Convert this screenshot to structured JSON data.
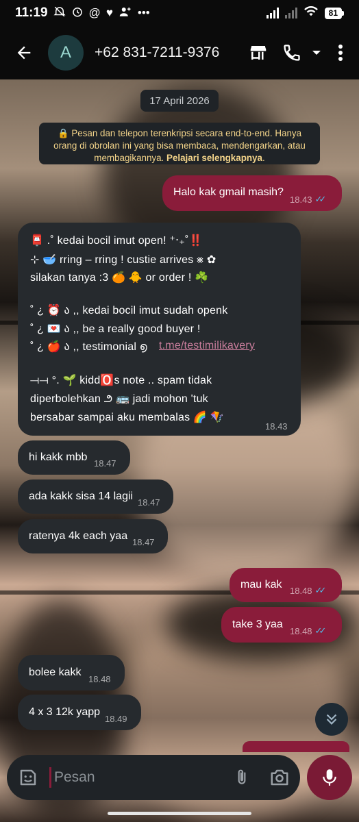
{
  "status_bar": {
    "time": "11:19",
    "icons": [
      "alarm-off-icon",
      "alarm-icon",
      "at-icon",
      "heart-icon",
      "add-user-icon",
      "more-dots-icon"
    ],
    "battery": "81"
  },
  "header": {
    "avatar_letter": "A",
    "contact_name": "+62 831-7211-9376"
  },
  "chat": {
    "date": "17 April 2026",
    "encryption_notice": "🔒 Pesan dan telepon terenkripsi secara end-to-end. Hanya orang di obrolan ini yang bisa membaca, mendengarkan, atau membagikannya.",
    "encryption_link": "Pelajari selengkapnya",
    "encryption_period": ".",
    "messages": [
      {
        "text": "Halo kak gmail masih?",
        "time": "18.43",
        "direction": "out",
        "read": true
      },
      {
        "time": "18.43",
        "direction": "in",
        "lines": [
          "📮  .˚ kedai  bocil  imut  open!  ⁺‧₊˚‼️",
          "⊹ 🥣 rring – rring !  custie  arrives ⨳ ✿",
          "silakan  tanya  :3 🍊 🐥  or  order ! ☘️",
          "",
          "˚ ¿ ⏰  ა  ,,  kedai bocil imut sudah openk",
          "˚ ¿ 💌  ა  ,,  be  a  really  good  buyer !",
          "˚ ¿ 🍎  ა  ,,  testimonial  ൭",
          "",
          "⟞⟞ °. 🌱  kidd🅾️s note  ..  spam  tidak",
          "diperbolehkan  ౨ 🚌  jadi  mohon  'tuk",
          "bersabar sampai aku membalas 🌈 🪁"
        ],
        "link": "t.me/testimilikavery"
      },
      {
        "text": "hi kakk mbb",
        "time": "18.47",
        "direction": "in"
      },
      {
        "text": "ada kakk sisa 14 lagii",
        "time": "18.47",
        "direction": "in"
      },
      {
        "text": "ratenya 4k each yaa",
        "time": "18.47",
        "direction": "in"
      },
      {
        "text": "mau kak",
        "time": "18.48",
        "direction": "out",
        "read": true
      },
      {
        "text": "take 3 yaa",
        "time": "18.48",
        "direction": "out",
        "read": true
      },
      {
        "text": "bolee kakk",
        "time": "18.48",
        "direction": "in"
      },
      {
        "text": "4 x 3 12k yapp",
        "time": "18.49",
        "direction": "in"
      }
    ]
  },
  "input": {
    "placeholder": "Pesan"
  },
  "colors": {
    "outgoing_bubble": "#8a1c3a",
    "incoming_bubble": "#262a2e",
    "read_ticks": "#53bdeb",
    "header_bg": "#0b0b0b"
  }
}
